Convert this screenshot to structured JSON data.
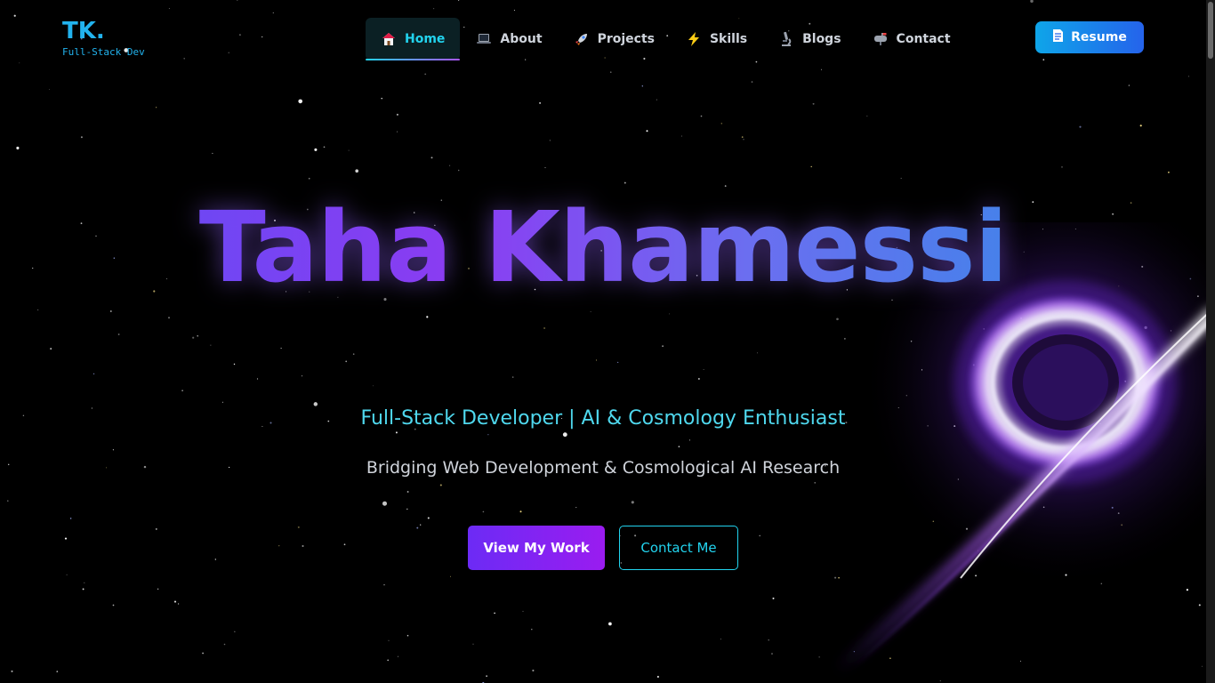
{
  "brand": {
    "mark": "TK.",
    "tagline": "Full-Stack Dev"
  },
  "nav": {
    "items": [
      {
        "label": "Home",
        "icon": "house-icon",
        "active": true
      },
      {
        "label": "About",
        "icon": "laptop-icon",
        "active": false
      },
      {
        "label": "Projects",
        "icon": "rocket-icon",
        "active": false
      },
      {
        "label": "Skills",
        "icon": "lightning-icon",
        "active": false
      },
      {
        "label": "Blogs",
        "icon": "microscope-icon",
        "active": false
      },
      {
        "label": "Contact",
        "icon": "mailbox-icon",
        "active": false
      }
    ],
    "resume": {
      "label": "Resume",
      "icon": "document-icon"
    }
  },
  "hero": {
    "name": "Taha Khamessi",
    "title": "Full-Stack Developer | AI & Cosmology Enthusiast",
    "subtitle": "Bridging Web Development & Cosmological AI Research",
    "primary_cta": "View My Work",
    "secondary_cta": "Contact Me"
  },
  "colors": {
    "accent": "#22d3ee",
    "purple": "#8b5cf6",
    "background": "#000000"
  }
}
